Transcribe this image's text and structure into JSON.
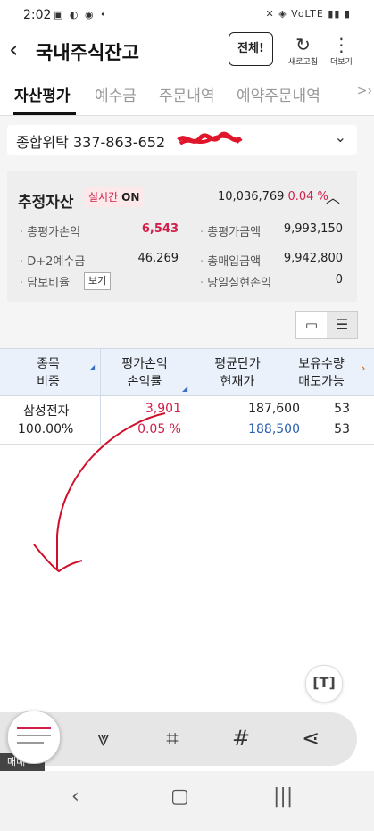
{
  "status": {
    "time": "2:02",
    "left_icons": "▣ ◐ ◉ •",
    "right_icons": "✕ ◈ VoLTE ▮▮ ▮"
  },
  "header": {
    "back_icon": "‹",
    "title": "국내주식잔고",
    "all_button": "전체",
    "refresh_label": "새로고침",
    "more_label": "더보기"
  },
  "tabs": [
    "자산평가",
    "예수금",
    "주문내역",
    "예약주문내역"
  ],
  "account": {
    "text": "종합위탁 337-863-652"
  },
  "summary": {
    "title": "추정자산",
    "realtime_label": "실시간",
    "realtime_state": "ON",
    "total_value": "10,036,769",
    "total_pct": "0.04 %",
    "rows": [
      {
        "label": "총평가손익",
        "value": "6,543"
      },
      {
        "label": "총평가금액",
        "value": "9,993,150"
      },
      {
        "label": "D+2예수금",
        "value": "46,269"
      },
      {
        "label": "총매입금액",
        "value": "9,942,800"
      },
      {
        "label": "담보비율",
        "button": "보기"
      },
      {
        "label": "당일실현손익",
        "value": "0"
      }
    ]
  },
  "table": {
    "headers": [
      {
        "line1": "종목",
        "line2": "비중"
      },
      {
        "line1": "평가손익",
        "line2": "손익률"
      },
      {
        "line1": "평균단가",
        "line2": "현재가"
      },
      {
        "line1": "보유수량",
        "line2": "매도가능"
      }
    ],
    "rows": [
      {
        "name": "삼성전자",
        "weight": "100.00%",
        "pnl": "3,901",
        "pnl_rate": "0.05 %",
        "avg_price": "187,600",
        "cur_price": "188,500",
        "qty": "53",
        "sellable": "53"
      }
    ]
  },
  "footer": {
    "strip_text": "매매"
  },
  "colors": {
    "red": "#d0204a",
    "blue": "#2a5db0",
    "header_bg": "#eaf1fb"
  }
}
